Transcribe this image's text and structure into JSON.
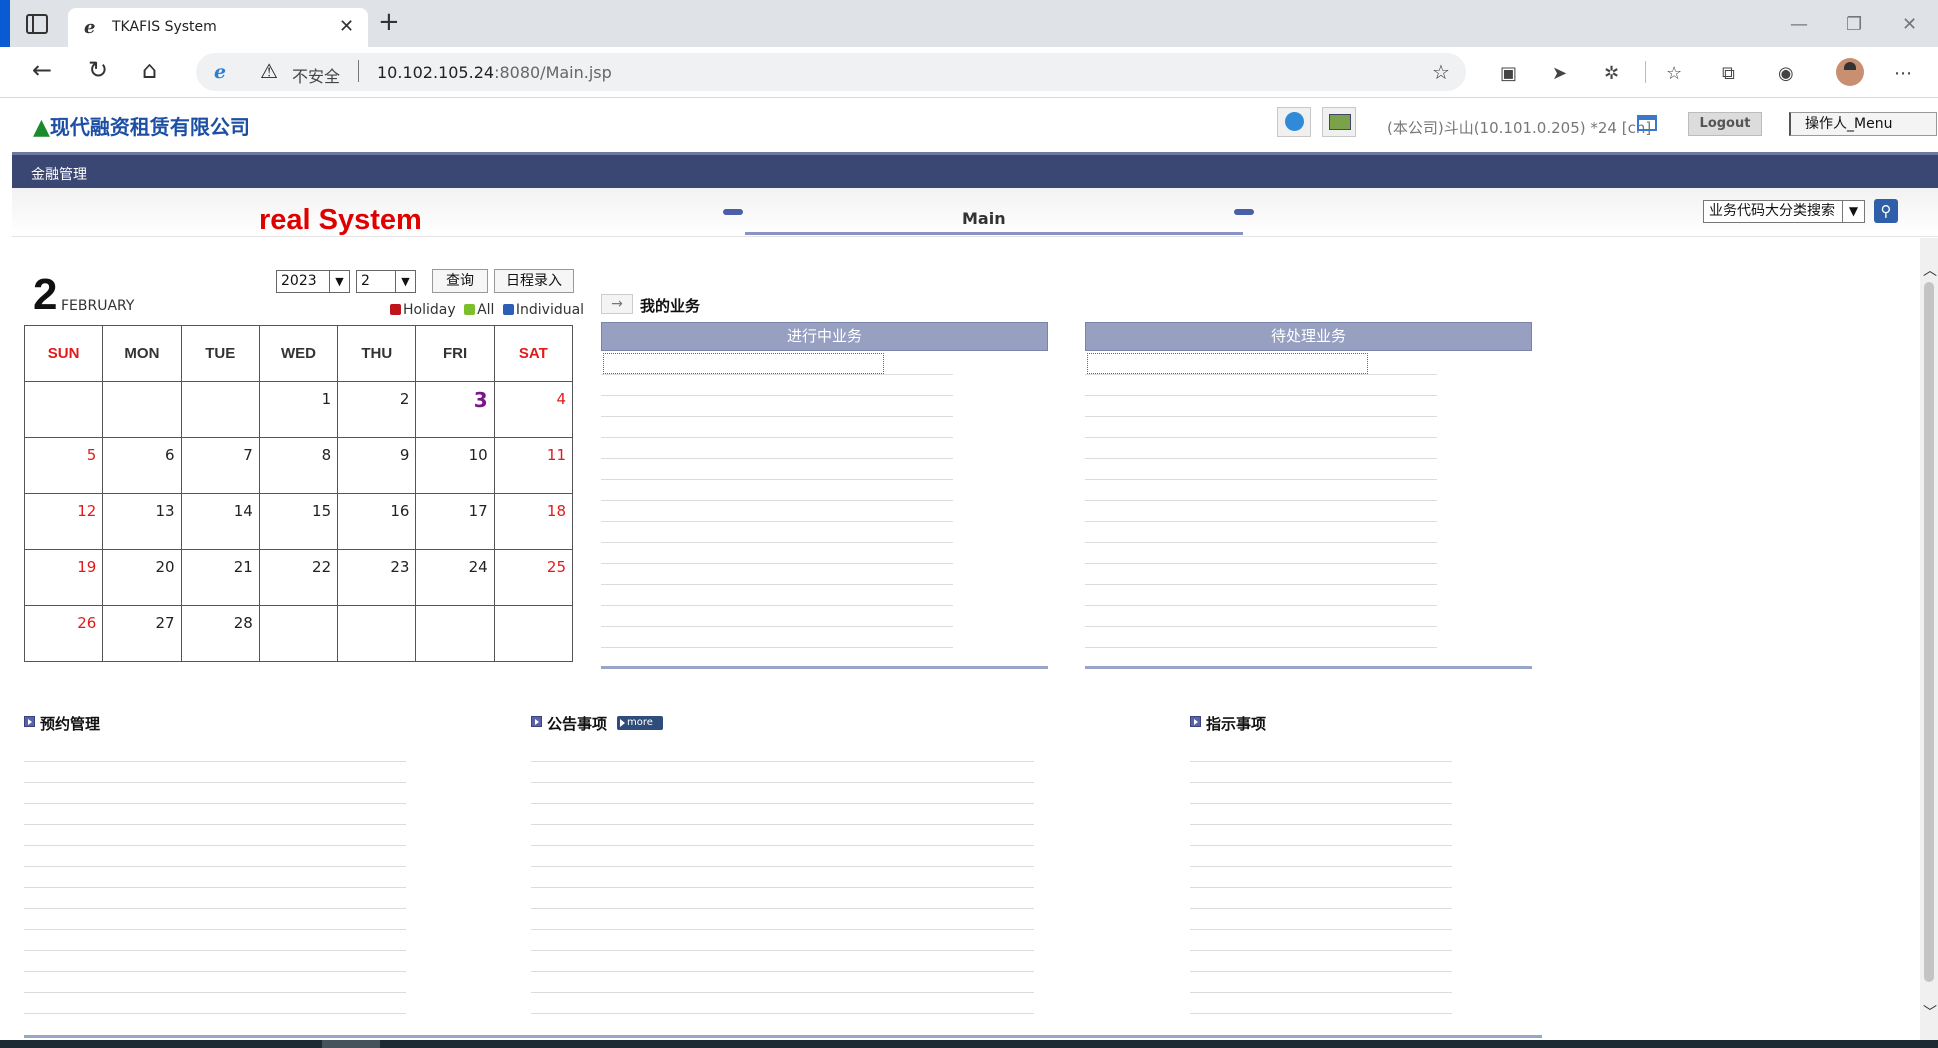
{
  "browser": {
    "tab_title": "TKAFIS System",
    "tab_icon": "ie-icon",
    "new_tab": "+",
    "security_label": "不安全",
    "url_host": "10.102.105.24",
    "url_rest": ":8080/Main.jsp"
  },
  "header": {
    "logo_text": "现代融资租赁有限公司",
    "session_info": "(本公司)斗山(10.101.0.205) *24 [cn]",
    "logout_label": "Logout",
    "menu_label": "操作人_Menu"
  },
  "nav": {
    "items": [
      "金融管理"
    ]
  },
  "title_strip": {
    "system_title": "real System",
    "tab_label": "Main",
    "search_select_value": "业务代码大分类搜索"
  },
  "calendar": {
    "day": "2",
    "month_name": "FEBRUARY",
    "year_value": "2023",
    "month_value": "2",
    "query_label": "查询",
    "schedule_label": "日程录入",
    "legend": [
      {
        "label": "Holiday",
        "color": "#c0141a"
      },
      {
        "label": "All",
        "color": "#7cbf2a"
      },
      {
        "label": "Individual",
        "color": "#2a5fb5"
      }
    ],
    "weekdays": [
      "SUN",
      "MON",
      "TUE",
      "WED",
      "THU",
      "FRI",
      "SAT"
    ],
    "weeks": [
      [
        "",
        "",
        "",
        "1",
        "2",
        "3",
        "4"
      ],
      [
        "5",
        "6",
        "7",
        "8",
        "9",
        "10",
        "11"
      ],
      [
        "12",
        "13",
        "14",
        "15",
        "16",
        "17",
        "18"
      ],
      [
        "19",
        "20",
        "21",
        "22",
        "23",
        "24",
        "25"
      ],
      [
        "26",
        "27",
        "28",
        "",
        "",
        "",
        ""
      ]
    ],
    "today": "3"
  },
  "my_business": {
    "title": "我的业务",
    "in_progress_label": "进行中业务",
    "pending_label": "待处理业务"
  },
  "sections": {
    "reservation_title": "预约管理",
    "notice_title": "公告事项",
    "more_label": "more",
    "instruction_title": "指示事项"
  },
  "colors": {
    "nav_bar": "#3a4772",
    "title_red": "#e00000",
    "header_bar": "#98a0c2",
    "logo_blue": "#1c4fa3"
  }
}
